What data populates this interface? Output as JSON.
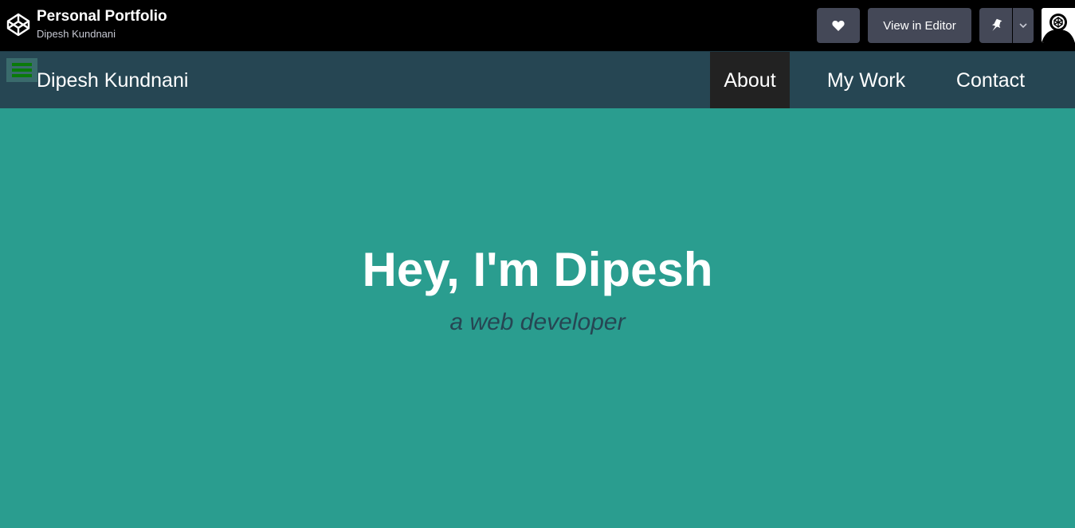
{
  "codepen": {
    "pen_title": "Personal Portfolio",
    "author": "Dipesh Kundnani",
    "view_in_editor_label": "View in Editor"
  },
  "nav": {
    "brand": "Dipesh Kundnani",
    "links": [
      {
        "label": "About",
        "active": true
      },
      {
        "label": "My Work",
        "active": false
      },
      {
        "label": "Contact",
        "active": false
      }
    ]
  },
  "hero": {
    "title": "Hey, I'm Dipesh",
    "subtitle": "a web developer"
  },
  "colors": {
    "topbar_bg": "#000000",
    "button_bg": "#444857",
    "nav_bg": "#264653",
    "active_nav_bg": "#222222",
    "hero_bg": "#2a9d8f",
    "subtitle_color": "#264653"
  },
  "icons": {
    "logo": "codepen-logo-icon",
    "heart": "heart-icon",
    "pin": "pin-icon",
    "chevron": "chevron-down-icon",
    "menu": "hamburger-menu-icon"
  }
}
